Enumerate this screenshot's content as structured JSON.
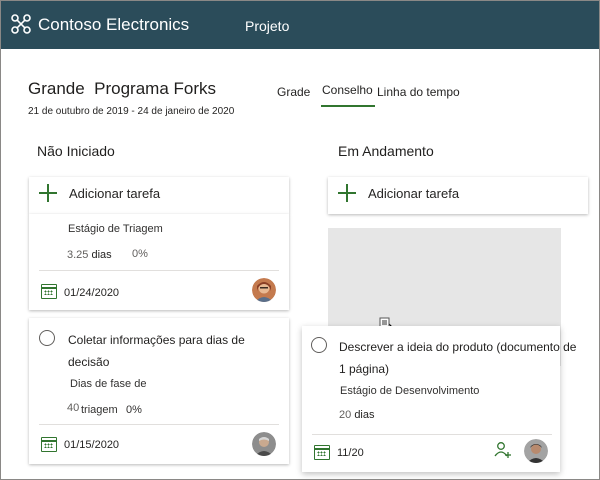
{
  "header": {
    "app_name": "Contoso Electronics",
    "project_link": "Projeto",
    "colors": {
      "bar": "#2b4c5a",
      "accent": "#31752f"
    }
  },
  "plan": {
    "title": "Grande  Programa Forks",
    "dates": "21 de outubro de 2019 - 24 de janeiro de 2020"
  },
  "tabs": [
    {
      "label": "Grade"
    },
    {
      "label": "Conselho",
      "active": true
    },
    {
      "label": "Linha do tempo"
    }
  ],
  "buckets": [
    {
      "title": "Não Iniciado",
      "add_task_label": "Adicionar tarefa",
      "cards": [
        {
          "stage": "Estágio de Triagem",
          "duration_value": "3.25",
          "duration_unit": "dias",
          "progress": "0%",
          "due_date": "01/24/2020",
          "icon": "calendar-icon"
        },
        {
          "title_line1": "Coletar informações para dias de",
          "title_line2": "decisão",
          "stage_line1": "Dias de fase de",
          "duration_value": "40",
          "stage_line2": "triagem",
          "progress": "0%",
          "due_date": "01/15/2020",
          "icon": "calendar-icon"
        }
      ]
    },
    {
      "title": "Em Andamento",
      "add_task_label": "Adicionar tarefa",
      "cards": [
        {
          "title_line1": "Descrever a ideia do produto (documento de",
          "title_line2": "1 página)",
          "stage": "Estágio de Desenvolvimento",
          "duration_value": "20",
          "duration_unit": "dias",
          "due_date": "11/20",
          "icon": "calendar-icon",
          "assign_icon": "assign-person-icon"
        }
      ]
    }
  ]
}
